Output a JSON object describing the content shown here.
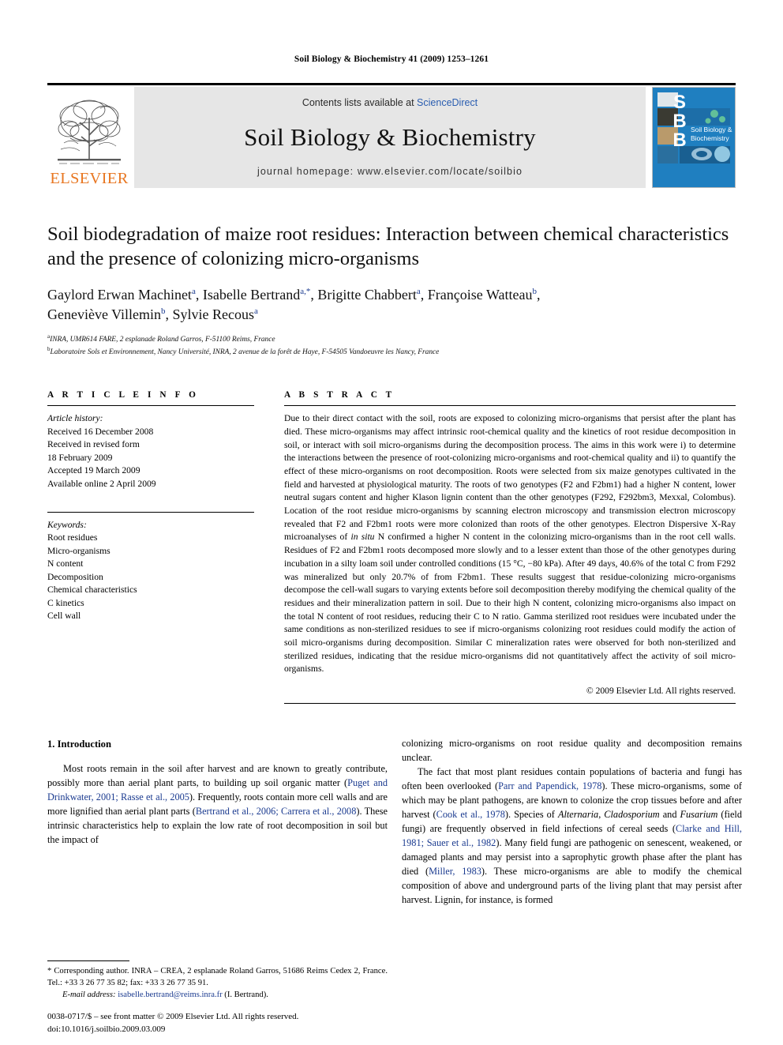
{
  "running_head": "Soil Biology & Biochemistry 41 (2009) 1253–1261",
  "masthead": {
    "publisher_name": "ELSEVIER",
    "contents_prefix": "Contents lists available at ",
    "contents_link": "ScienceDirect",
    "journal_title": "Soil Biology & Biochemistry",
    "homepage": "journal homepage: www.elsevier.com/locate/soilbio",
    "cover_letters": [
      "S",
      "B",
      "B"
    ],
    "cover_title_line1": "Soil Biology &",
    "cover_title_line2": "Biochemistry",
    "colors": {
      "elsevier_orange": "#E87722",
      "link_blue": "#2a5db0",
      "banner_grey": "#e6e6e6",
      "cover_blue": "#1f7fc0",
      "reference_blue": "#1a3a8f"
    }
  },
  "article": {
    "title": "Soil biodegradation of maize root residues: Interaction between chemical characteristics and the presence of colonizing micro-organisms",
    "authors_line1_html": "Gaylord Erwan Machinet<sup>a</sup>, Isabelle Bertrand<sup>a,*</sup>, Brigitte Chabbert<sup>a</sup>, Françoise Watteau<sup>b</sup>,",
    "authors_line2_html": "Geneviève Villemin<sup>b</sup>, Sylvie Recous<sup>a</sup>",
    "affiliation_a": "INRA, UMR614 FARE, 2 esplanade Roland Garros, F-51100 Reims, France",
    "affiliation_b": "Laboratoire Sols et Environnement, Nancy Université, INRA, 2 avenue de la forêt de Haye, F-54505 Vandoeuvre les Nancy, France",
    "affiliation_a_marker": "a",
    "affiliation_b_marker": "b"
  },
  "article_info": {
    "section_label": "A R T I C L E   I N F O",
    "history_label": "Article history:",
    "history": [
      "Received 16 December 2008",
      "Received in revised form",
      "18 February 2009",
      "Accepted 19 March 2009",
      "Available online 2 April 2009"
    ],
    "keywords_label": "Keywords:",
    "keywords": [
      "Root residues",
      "Micro-organisms",
      "N content",
      "Decomposition",
      "Chemical characteristics",
      "C kinetics",
      "Cell wall"
    ]
  },
  "abstract": {
    "section_label": "A B S T R A C T",
    "paragraph_1": "Due to their direct contact with the soil, roots are exposed to colonizing micro-organisms that persist after the plant has died. These micro-organisms may affect intrinsic root-chemical quality and the kinetics of root residue decomposition in soil, or interact with soil micro-organisms during the decomposition process. The aims in this work were i) to determine the interactions between the presence of root-colonizing micro-organisms and root-chemical quality and ii) to quantify the effect of these micro-organisms on root decomposition. Roots were selected from six maize genotypes cultivated in the field and harvested at physiological maturity. The roots of two genotypes (F2 and F2bm1) had a higher N content, lower neutral sugars content and higher Klason lignin content than the other genotypes (F292, F292bm3, Mexxal, Colombus). Location of the root residue micro-organisms by scanning electron microscopy and transmission electron microscopy revealed that F2 and F2bm1 roots were more colonized than roots of the other genotypes. Electron Dispersive X-Ray microanalyses of ",
    "italic_1": "in situ",
    "paragraph_1b": " N confirmed a higher N content in the colonizing micro-organisms than in the root cell walls. Residues of F2 and F2bm1 roots decomposed more slowly and to a lesser extent than those of the other genotypes during incubation in a silty loam soil under controlled conditions (15 °C, −80 kPa). After 49 days, 40.6% of the total C from F292 was mineralized but only 20.7% of from F2bm1. These results suggest that residue-colonizing micro-organisms decompose the cell-wall sugars to varying extents before soil decomposition thereby modifying the chemical quality of the residues and their mineralization pattern in soil. Due to their high N content, colonizing micro-organisms also impact on the total N content of root residues, reducing their C to N ratio. Gamma sterilized root residues were incubated under the same conditions as non-sterilized residues to see if micro-organisms colonizing root residues could modify the action of soil micro-organisms during decomposition. Similar C mineralization rates were observed for both non-sterilized and sterilized residues, indicating that the residue micro-organisms did not quantitatively affect the activity of soil micro-organisms.",
    "copyright": "© 2009 Elsevier Ltd. All rights reserved."
  },
  "introduction": {
    "heading": "1. Introduction",
    "left_p1_part1": "Most roots remain in the soil after harvest and are known to greatly contribute, possibly more than aerial plant parts, to building up soil organic matter (",
    "left_ref1": "Puget and Drinkwater, 2001; Rasse et al., 2005",
    "left_p1_part2": "). Frequently, roots contain more cell walls and are more lignified than aerial plant parts (",
    "left_ref2": "Bertrand et al., 2006; Carrera et al., 2008",
    "left_p1_part3": "). These intrinsic characteristics help to explain the low rate of root decomposition in soil but the impact of",
    "right_p0": "colonizing micro-organisms on root residue quality and decomposition remains unclear.",
    "right_p1_part1": "The fact that most plant residues contain populations of bacteria and fungi has often been overlooked (",
    "right_ref1": "Parr and Papendick, 1978",
    "right_p1_part2": "). These micro-organisms, some of which may be plant pathogens, are known to colonize the crop tissues before and after harvest (",
    "right_ref2": "Cook et al., 1978",
    "right_p1_part3": "). Species of ",
    "right_italic1": "Alternaria",
    "right_p1_part4": ", ",
    "right_italic2": "Cladosporium",
    "right_p1_part5": " and ",
    "right_italic3": "Fusarium",
    "right_p1_part6": " (field fungi) are frequently observed in field infections of cereal seeds (",
    "right_ref3": "Clarke and Hill, 1981; Sauer et al., 1982",
    "right_p1_part7": "). Many field fungi are pathogenic on senescent, weakened, or damaged plants and may persist into a saprophytic growth phase after the plant has died (",
    "right_ref4": "Miller, 1983",
    "right_p1_part8": "). These micro-organisms are able to modify the chemical composition of above and underground parts of the living plant that may persist after harvest. Lignin, for instance, is formed"
  },
  "footnotes": {
    "corresponding": "* Corresponding author. INRA – CREA, 2 esplanade Roland Garros, 51686 Reims Cedex 2, France. Tel.: +33 3 26 77 35 82; fax: +33 3 26 77 35 91.",
    "email_label": "E-mail address:",
    "email_address": "isabelle.bertrand@reims.inra.fr",
    "email_suffix": " (I. Bertrand)."
  },
  "issn": {
    "line1": "0038-0717/$ – see front matter © 2009 Elsevier Ltd. All rights reserved.",
    "line2": "doi:10.1016/j.soilbio.2009.03.009"
  }
}
